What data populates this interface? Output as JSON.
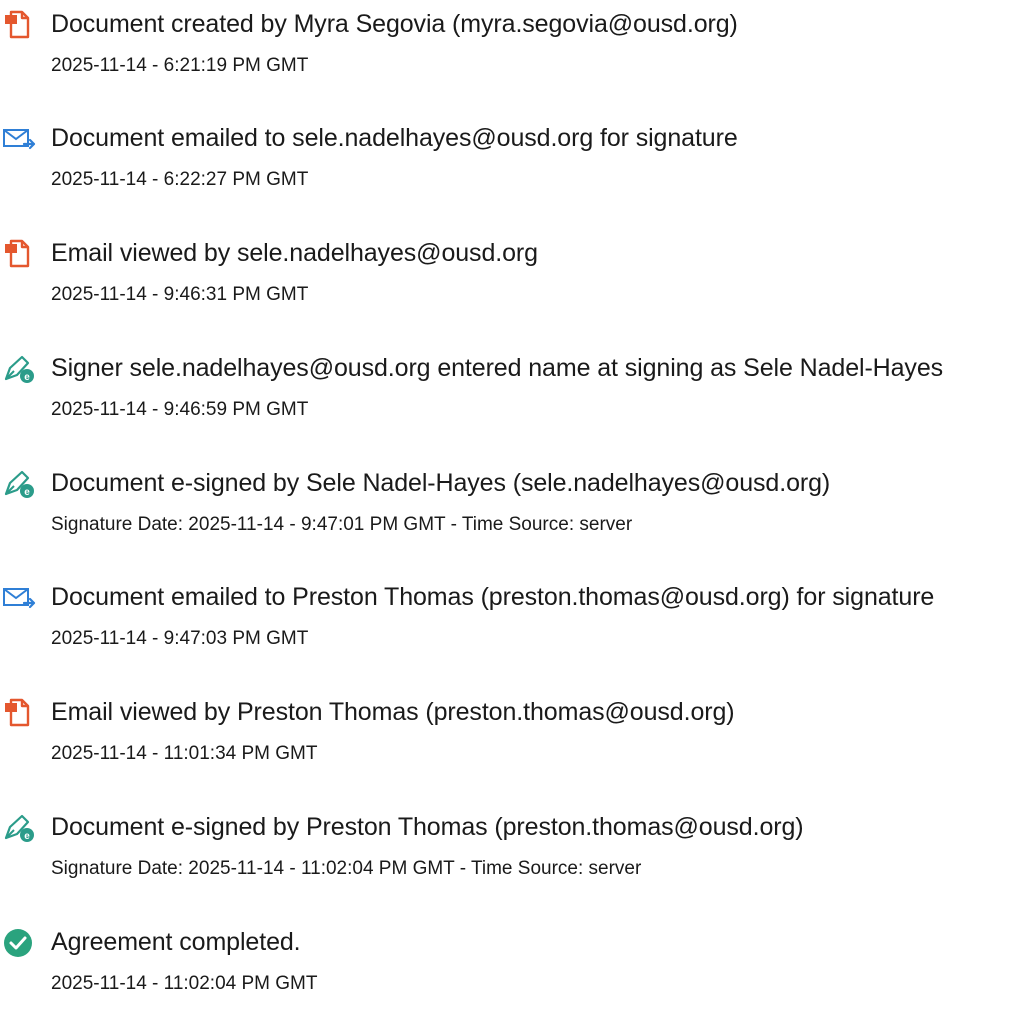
{
  "events": [
    {
      "icon": "document-icon",
      "title": "Document created by Myra Segovia (myra.segovia@ousd.org)",
      "meta": "2025-11-14 - 6:21:19 PM GMT"
    },
    {
      "icon": "email-send-icon",
      "title": "Document emailed to sele.nadelhayes@ousd.org for signature",
      "meta": "2025-11-14 - 6:22:27 PM GMT"
    },
    {
      "icon": "document-icon",
      "title": "Email viewed by sele.nadelhayes@ousd.org",
      "meta": "2025-11-14 - 9:46:31 PM GMT"
    },
    {
      "icon": "esign-pen-icon",
      "title": "Signer sele.nadelhayes@ousd.org entered name at signing as Sele Nadel-Hayes",
      "meta": "2025-11-14 - 9:46:59 PM GMT"
    },
    {
      "icon": "esign-pen-icon",
      "title": "Document e-signed by Sele Nadel-Hayes (sele.nadelhayes@ousd.org)",
      "meta": "Signature Date: 2025-11-14 - 9:47:01 PM GMT - Time Source: server"
    },
    {
      "icon": "email-send-icon",
      "title": "Document emailed to Preston Thomas (preston.thomas@ousd.org) for signature",
      "meta": "2025-11-14 - 9:47:03 PM GMT"
    },
    {
      "icon": "document-icon",
      "title": "Email viewed by Preston Thomas (preston.thomas@ousd.org)",
      "meta": "2025-11-14 - 11:01:34 PM GMT"
    },
    {
      "icon": "esign-pen-icon",
      "title": "Document e-signed by Preston Thomas (preston.thomas@ousd.org)",
      "meta": "Signature Date: 2025-11-14 - 11:02:04 PM GMT - Time Source: server"
    },
    {
      "icon": "check-circle-icon",
      "title": "Agreement completed.",
      "meta": "2025-11-14 - 11:02:04 PM GMT"
    }
  ],
  "colors": {
    "document_icon": "#e4572e",
    "email_icon": "#2f7fd6",
    "esign_icon": "#2b9c8a",
    "check_icon": "#2aa37e",
    "text": "#1a1a1a"
  }
}
